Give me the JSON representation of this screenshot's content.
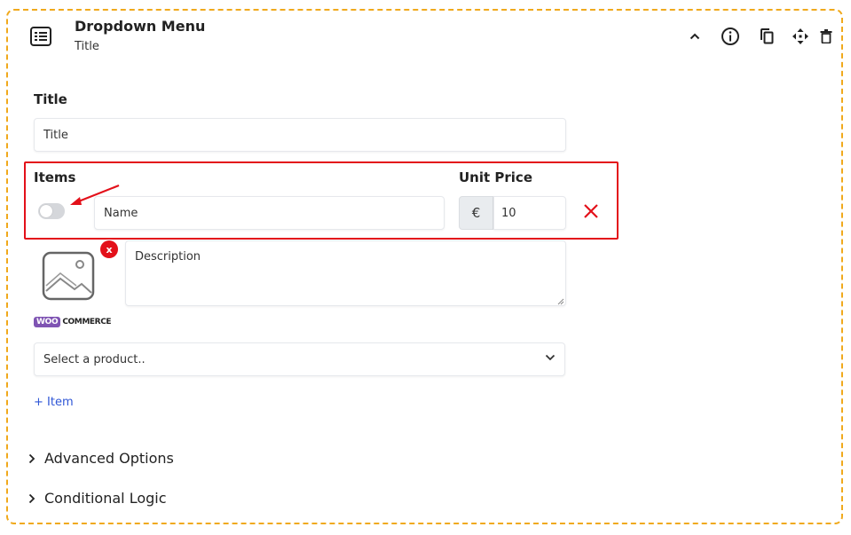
{
  "header": {
    "title": "Dropdown Menu",
    "subtitle": "Title"
  },
  "toolbar": {
    "icons": [
      "chevron-up-icon",
      "info-icon",
      "duplicate-icon",
      "move-icon",
      "trash-icon"
    ]
  },
  "title_field": {
    "label": "Title",
    "value": "Title"
  },
  "items": {
    "label": "Items",
    "unit_price_label": "Unit Price",
    "rows": [
      {
        "toggle_on": false,
        "name_placeholder": "Name",
        "currency_symbol": "€",
        "price": "10",
        "description_placeholder": "Description",
        "woo_logo": "WOO COMMERCE",
        "product_placeholder": "Select a product.."
      }
    ],
    "add_label": "+ Item"
  },
  "sections": {
    "advanced": "Advanced Options",
    "conditional": "Conditional Logic"
  },
  "colors": {
    "frame_border": "#f0a91c",
    "highlight": "#e3101a",
    "link": "#2f56d6",
    "woo_purple": "#7f54b3"
  }
}
